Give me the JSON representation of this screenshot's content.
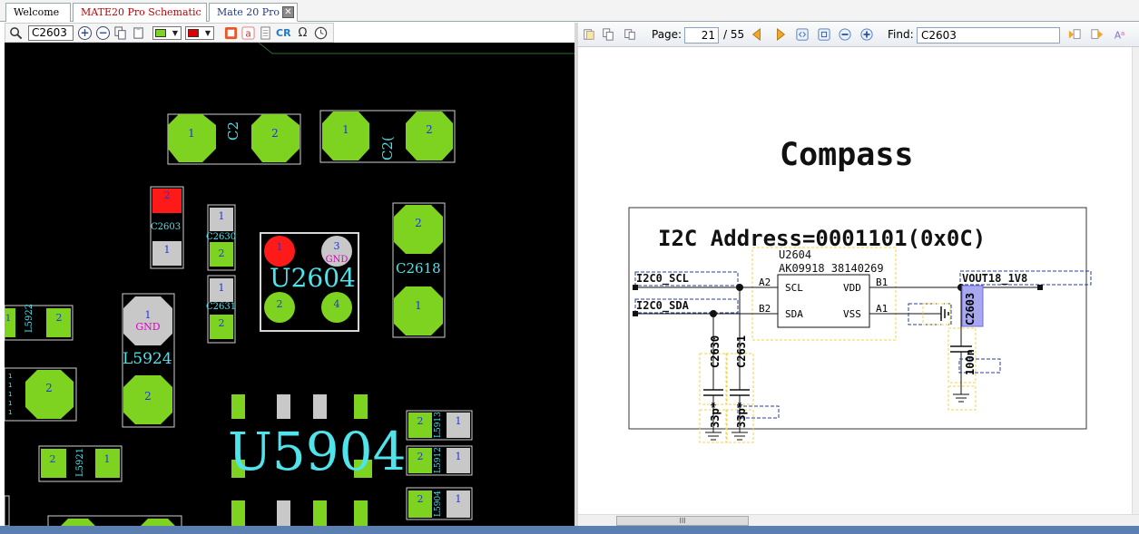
{
  "tabs": [
    "Welcome",
    "MATE20 Pro Schematic",
    "Mate 20 Pro"
  ],
  "tab_close_glyph": "✕",
  "left_toolbar": {
    "search_value": "C2603",
    "ocr_label": "CR",
    "omega_label": "Ω",
    "layer_color_1": "#7ed321",
    "layer_color_2": "#e00000"
  },
  "board": {
    "labels": {
      "c2_a": "C2",
      "c2_b": "C2(",
      "c2603": "C2603",
      "c2630": "C2630",
      "c2631": "C2631",
      "u2604": "U2604",
      "c2618": "C2618",
      "l5922": "L5922",
      "l5924": "L5924",
      "l5921": "L5921",
      "u5904": "U5904",
      "l5913": "L5913",
      "l5912": "L5912",
      "l5904": "L5904",
      "gnd": "GND"
    },
    "pad_numbers": [
      "1",
      "2",
      "3",
      "4"
    ],
    "colors": {
      "pad": "#7ed321",
      "highlight": "#ff1a1a",
      "gray": "#c8c8c8",
      "label": "#4fe3ec"
    }
  },
  "pdf_toolbar": {
    "page_label": "Page:",
    "page_value": "21",
    "page_total": "/ 55",
    "find_label": "Find:",
    "find_value": "C2603"
  },
  "schematic": {
    "title": "Compass",
    "i2c_address": "I2C Address=0001101(0x0C)",
    "ic_ref": "U2604",
    "ic_part": "AK09918 38140269",
    "net_scl": "I2C0_SCL",
    "net_sda": "I2C0_SDA",
    "net_vout": "VOUT18_1V8",
    "pins": {
      "a2": "A2",
      "b2": "B2",
      "b1": "B1",
      "a1": "A1",
      "scl": "SCL",
      "sda": "SDA",
      "vdd": "VDD",
      "vss": "VSS"
    },
    "caps": [
      "C2630",
      "C2631",
      "C2603"
    ],
    "cap_values": [
      "33p*",
      "33p*",
      "100n"
    ]
  },
  "hscroll_grip": "III"
}
